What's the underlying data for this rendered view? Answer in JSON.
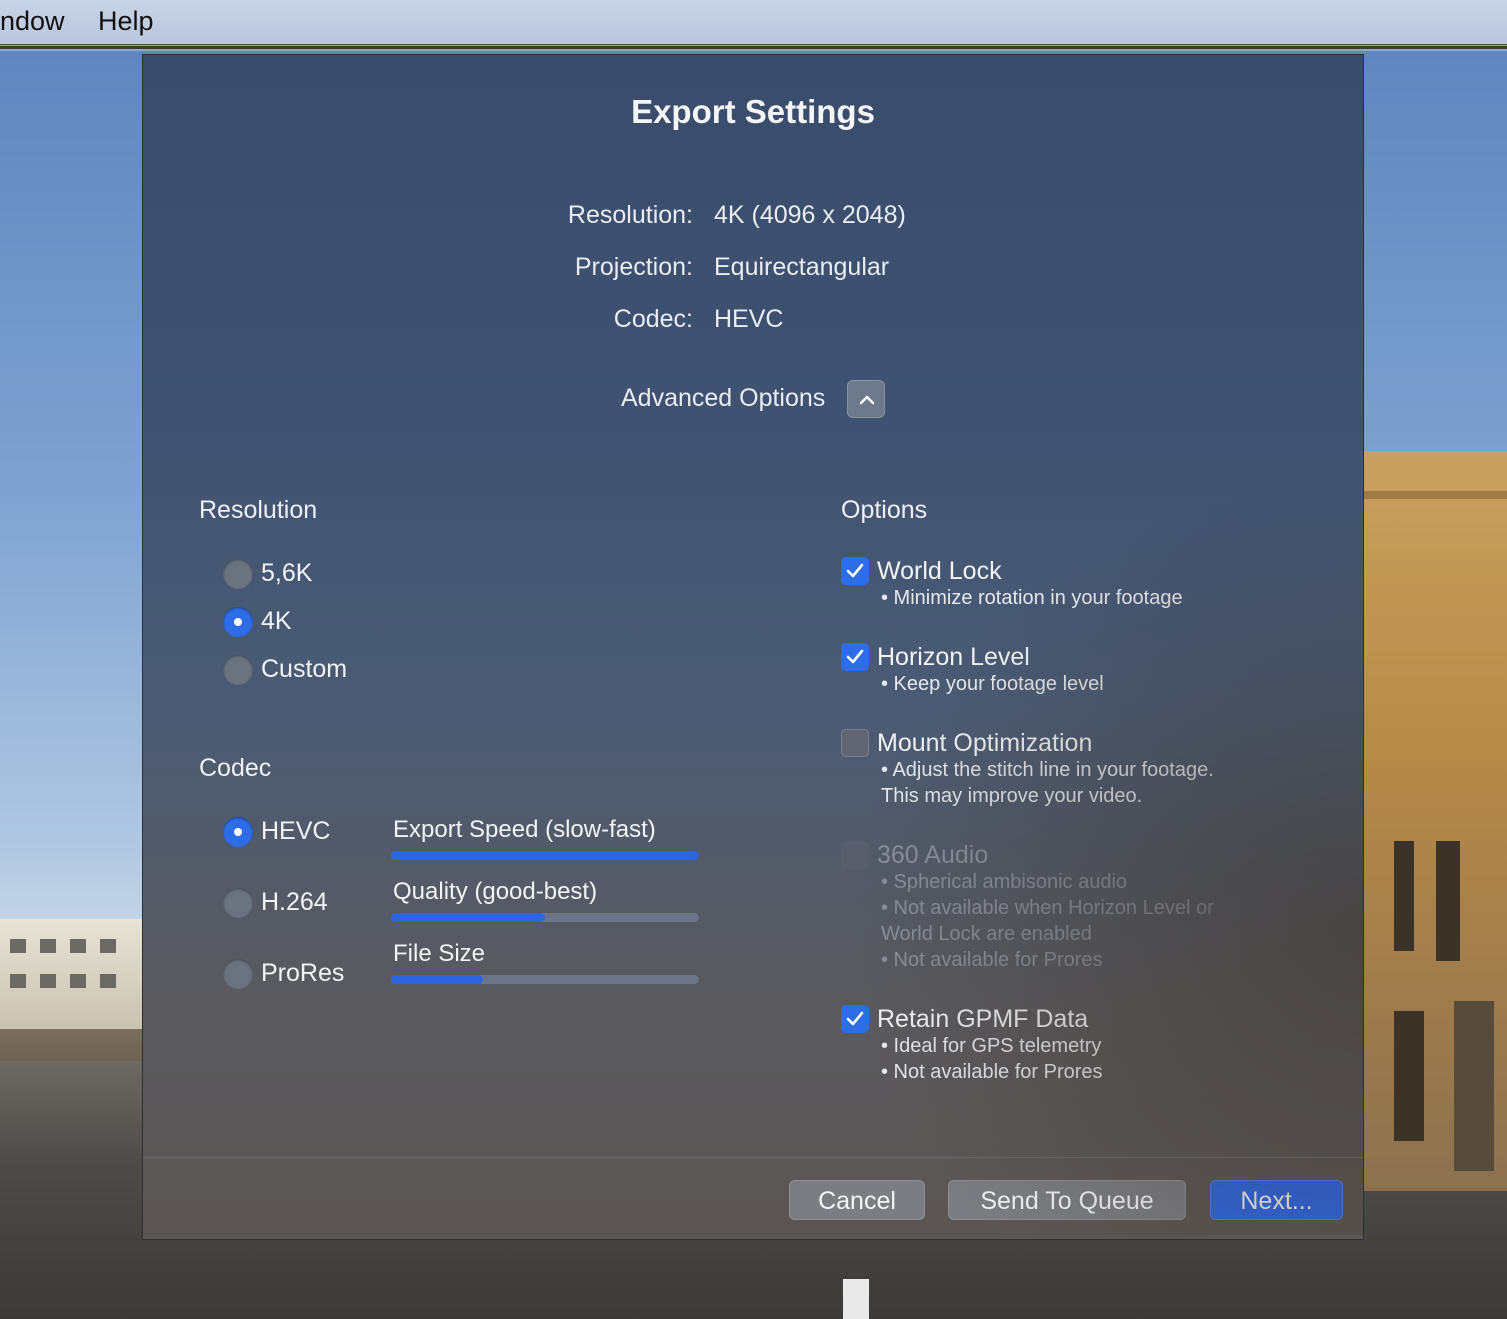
{
  "menubar": {
    "items": [
      "ndow",
      "Help"
    ]
  },
  "dialog": {
    "title": "Export Settings",
    "summary": [
      {
        "label": "Resolution:",
        "value": "4K (4096 x 2048)"
      },
      {
        "label": "Projection:",
        "value": "Equirectangular"
      },
      {
        "label": "Codec:",
        "value": "HEVC"
      }
    ],
    "advanced_options_label": "Advanced Options",
    "advanced_options_expanded": true,
    "resolution": {
      "heading": "Resolution",
      "options": [
        {
          "label": "5,6K",
          "selected": false
        },
        {
          "label": "4K",
          "selected": true
        },
        {
          "label": "Custom",
          "selected": false
        }
      ]
    },
    "codec": {
      "heading": "Codec",
      "options": [
        {
          "label": "HEVC",
          "selected": true
        },
        {
          "label": "H.264",
          "selected": false
        },
        {
          "label": "ProRes",
          "selected": false
        }
      ],
      "meters": [
        {
          "label": "Export Speed (slow-fast)",
          "level": 1.0
        },
        {
          "label": "Quality (good-best)",
          "level": 0.5
        },
        {
          "label": "File Size",
          "level": 0.3
        }
      ]
    },
    "options": {
      "heading": "Options",
      "items": [
        {
          "label": "World Lock",
          "checked": true,
          "disabled": false,
          "desc": [
            "• Minimize rotation in your footage"
          ]
        },
        {
          "label": "Horizon Level",
          "checked": true,
          "disabled": false,
          "desc": [
            "• Keep your footage level"
          ]
        },
        {
          "label": "Mount Optimization",
          "checked": false,
          "disabled": false,
          "desc": [
            "• Adjust the stitch line in your footage.",
            "This may improve your video."
          ]
        },
        {
          "label": "360 Audio",
          "checked": false,
          "disabled": true,
          "desc": [
            "• Spherical ambisonic audio",
            "• Not available when Horizon Level or",
            "World Lock are enabled",
            "• Not available for Prores"
          ]
        },
        {
          "label": "Retain GPMF Data",
          "checked": true,
          "disabled": false,
          "desc": [
            "• Ideal for GPS telemetry",
            "• Not available for Prores"
          ]
        }
      ]
    },
    "buttons": {
      "cancel": "Cancel",
      "queue": "Send To Queue",
      "next": "Next..."
    }
  },
  "colors": {
    "accent": "#2d6de8",
    "dialog_bg": "#3f5272"
  }
}
